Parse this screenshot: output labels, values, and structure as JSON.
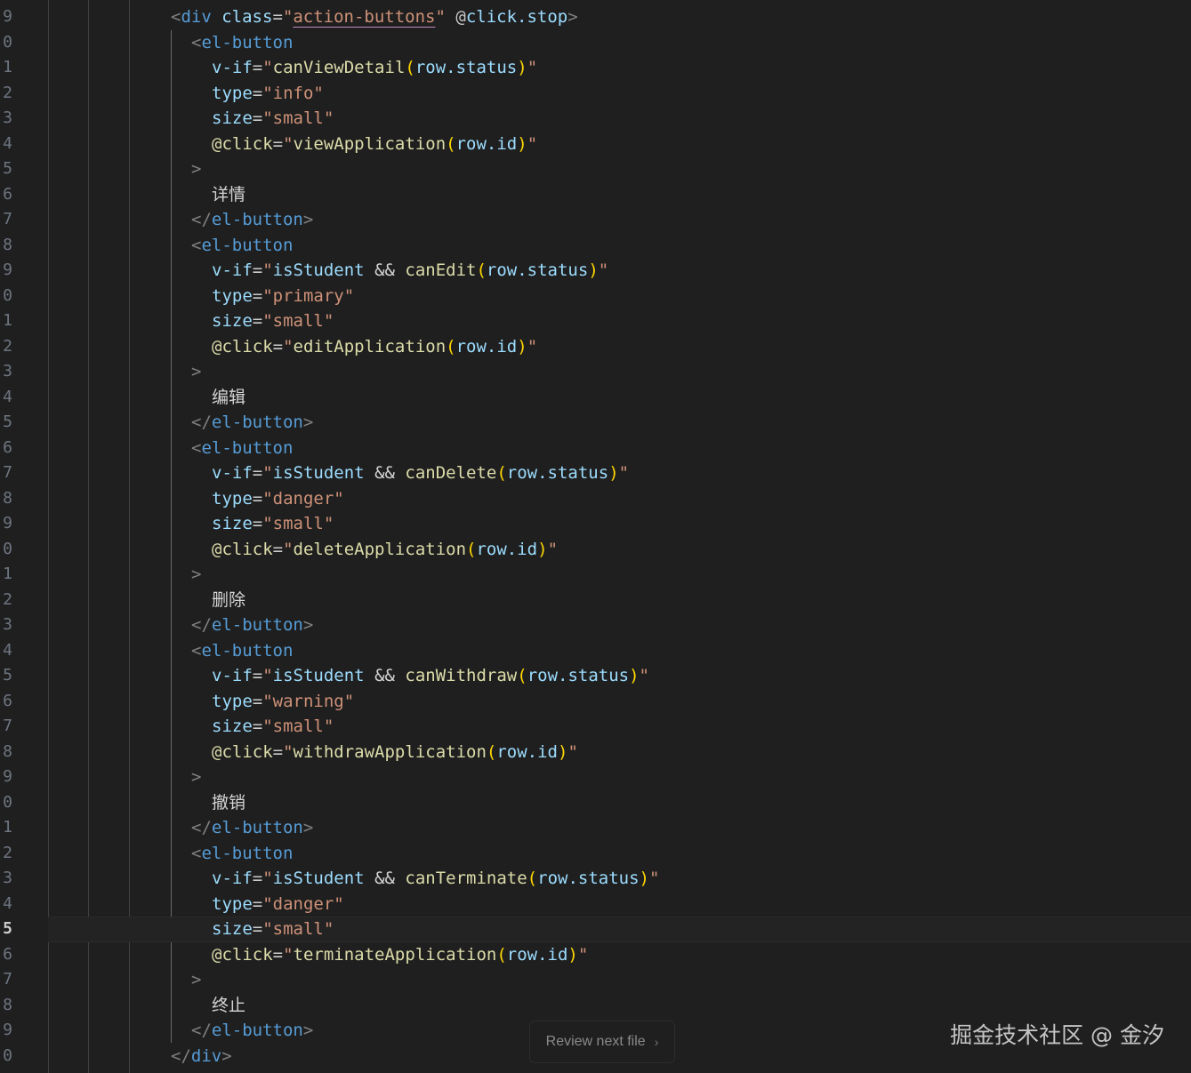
{
  "gutter": {
    "line_numbers": [
      "9",
      "0",
      "1",
      "2",
      "3",
      "4",
      "5",
      "6",
      "7",
      "8",
      "9",
      "0",
      "1",
      "2",
      "3",
      "4",
      "5",
      "6",
      "7",
      "8",
      "9",
      "0",
      "1",
      "2",
      "3",
      "4",
      "5",
      "6",
      "7",
      "8",
      "9",
      "0",
      "1",
      "2",
      "3",
      "4",
      "5",
      "6",
      "7",
      "8",
      "9",
      "0"
    ],
    "active_index": 36
  },
  "code_lines": [
    [
      [
        "t-br",
        "<"
      ],
      [
        "t-tag",
        "div"
      ],
      [
        "t-plain",
        " "
      ],
      [
        "t-attr",
        "class"
      ],
      [
        "t-eq",
        "="
      ],
      [
        "t-str",
        "\""
      ],
      [
        "t-str underlined",
        "action-buttons"
      ],
      [
        "t-str",
        "\""
      ],
      [
        "t-plain",
        " "
      ],
      [
        "t-at",
        "@"
      ],
      [
        "t-attr",
        "click.stop"
      ],
      [
        "t-br",
        ">"
      ]
    ],
    [
      [
        "t-br",
        "<"
      ],
      [
        "t-tag",
        "el-button"
      ]
    ],
    [
      [
        "t-attr",
        "v-if"
      ],
      [
        "t-eq",
        "="
      ],
      [
        "t-str",
        "\""
      ],
      [
        "t-fn",
        "canViewDetail"
      ],
      [
        "t-paren",
        "("
      ],
      [
        "t-var",
        "row.status"
      ],
      [
        "t-paren",
        ")"
      ],
      [
        "t-str",
        "\""
      ]
    ],
    [
      [
        "t-attr",
        "type"
      ],
      [
        "t-eq",
        "="
      ],
      [
        "t-str",
        "\"info\""
      ]
    ],
    [
      [
        "t-attr",
        "size"
      ],
      [
        "t-eq",
        "="
      ],
      [
        "t-str",
        "\"small\""
      ]
    ],
    [
      [
        "t-fn",
        "@click"
      ],
      [
        "t-eq",
        "="
      ],
      [
        "t-str",
        "\""
      ],
      [
        "t-fn",
        "viewApplication"
      ],
      [
        "t-paren",
        "("
      ],
      [
        "t-var",
        "row.id"
      ],
      [
        "t-paren",
        ")"
      ],
      [
        "t-str",
        "\""
      ]
    ],
    [
      [
        "t-br",
        ">"
      ]
    ],
    [
      [
        "t-cjk",
        "详情"
      ]
    ],
    [
      [
        "t-br",
        "</"
      ],
      [
        "t-tag",
        "el-button"
      ],
      [
        "t-br",
        ">"
      ]
    ],
    [
      [
        "t-br",
        "<"
      ],
      [
        "t-tag",
        "el-button"
      ]
    ],
    [
      [
        "t-attr",
        "v-if"
      ],
      [
        "t-eq",
        "="
      ],
      [
        "t-str",
        "\""
      ],
      [
        "t-var",
        "isStudent"
      ],
      [
        "t-plain",
        " && "
      ],
      [
        "t-fn",
        "canEdit"
      ],
      [
        "t-paren",
        "("
      ],
      [
        "t-var",
        "row.status"
      ],
      [
        "t-paren",
        ")"
      ],
      [
        "t-str",
        "\""
      ]
    ],
    [
      [
        "t-attr",
        "type"
      ],
      [
        "t-eq",
        "="
      ],
      [
        "t-str",
        "\"primary\""
      ]
    ],
    [
      [
        "t-attr",
        "size"
      ],
      [
        "t-eq",
        "="
      ],
      [
        "t-str",
        "\"small\""
      ]
    ],
    [
      [
        "t-fn",
        "@click"
      ],
      [
        "t-eq",
        "="
      ],
      [
        "t-str",
        "\""
      ],
      [
        "t-fn",
        "editApplication"
      ],
      [
        "t-paren",
        "("
      ],
      [
        "t-var",
        "row.id"
      ],
      [
        "t-paren",
        ")"
      ],
      [
        "t-str",
        "\""
      ]
    ],
    [
      [
        "t-br",
        ">"
      ]
    ],
    [
      [
        "t-cjk",
        "编辑"
      ]
    ],
    [
      [
        "t-br",
        "</"
      ],
      [
        "t-tag",
        "el-button"
      ],
      [
        "t-br",
        ">"
      ]
    ],
    [
      [
        "t-br",
        "<"
      ],
      [
        "t-tag",
        "el-button"
      ]
    ],
    [
      [
        "t-attr",
        "v-if"
      ],
      [
        "t-eq",
        "="
      ],
      [
        "t-str",
        "\""
      ],
      [
        "t-var",
        "isStudent"
      ],
      [
        "t-plain",
        " && "
      ],
      [
        "t-fn",
        "canDelete"
      ],
      [
        "t-paren",
        "("
      ],
      [
        "t-var",
        "row.status"
      ],
      [
        "t-paren",
        ")"
      ],
      [
        "t-str",
        "\""
      ]
    ],
    [
      [
        "t-attr",
        "type"
      ],
      [
        "t-eq",
        "="
      ],
      [
        "t-str",
        "\"danger\""
      ]
    ],
    [
      [
        "t-attr",
        "size"
      ],
      [
        "t-eq",
        "="
      ],
      [
        "t-str",
        "\"small\""
      ]
    ],
    [
      [
        "t-fn",
        "@click"
      ],
      [
        "t-eq",
        "="
      ],
      [
        "t-str",
        "\""
      ],
      [
        "t-fn",
        "deleteApplication"
      ],
      [
        "t-paren",
        "("
      ],
      [
        "t-var",
        "row.id"
      ],
      [
        "t-paren",
        ")"
      ],
      [
        "t-str",
        "\""
      ]
    ],
    [
      [
        "t-br",
        ">"
      ]
    ],
    [
      [
        "t-cjk",
        "删除"
      ]
    ],
    [
      [
        "t-br",
        "</"
      ],
      [
        "t-tag",
        "el-button"
      ],
      [
        "t-br",
        ">"
      ]
    ],
    [
      [
        "t-br",
        "<"
      ],
      [
        "t-tag",
        "el-button"
      ]
    ],
    [
      [
        "t-attr",
        "v-if"
      ],
      [
        "t-eq",
        "="
      ],
      [
        "t-str",
        "\""
      ],
      [
        "t-var",
        "isStudent"
      ],
      [
        "t-plain",
        " && "
      ],
      [
        "t-fn",
        "canWithdraw"
      ],
      [
        "t-paren",
        "("
      ],
      [
        "t-var",
        "row.status"
      ],
      [
        "t-paren",
        ")"
      ],
      [
        "t-str",
        "\""
      ]
    ],
    [
      [
        "t-attr",
        "type"
      ],
      [
        "t-eq",
        "="
      ],
      [
        "t-str",
        "\"warning\""
      ]
    ],
    [
      [
        "t-attr",
        "size"
      ],
      [
        "t-eq",
        "="
      ],
      [
        "t-str",
        "\"small\""
      ]
    ],
    [
      [
        "t-fn",
        "@click"
      ],
      [
        "t-eq",
        "="
      ],
      [
        "t-str",
        "\""
      ],
      [
        "t-fn",
        "withdrawApplication"
      ],
      [
        "t-paren",
        "("
      ],
      [
        "t-var",
        "row.id"
      ],
      [
        "t-paren",
        ")"
      ],
      [
        "t-str",
        "\""
      ]
    ],
    [
      [
        "t-br",
        ">"
      ]
    ],
    [
      [
        "t-cjk",
        "撤销"
      ]
    ],
    [
      [
        "t-br",
        "</"
      ],
      [
        "t-tag",
        "el-button"
      ],
      [
        "t-br",
        ">"
      ]
    ],
    [
      [
        "t-br",
        "<"
      ],
      [
        "t-tag",
        "el-button"
      ]
    ],
    [
      [
        "t-attr",
        "v-if"
      ],
      [
        "t-eq",
        "="
      ],
      [
        "t-str",
        "\""
      ],
      [
        "t-var",
        "isStudent"
      ],
      [
        "t-plain",
        " && "
      ],
      [
        "t-fn",
        "canTerminate"
      ],
      [
        "t-paren",
        "("
      ],
      [
        "t-var",
        "row.status"
      ],
      [
        "t-paren",
        ")"
      ],
      [
        "t-str",
        "\""
      ]
    ],
    [
      [
        "t-attr",
        "type"
      ],
      [
        "t-eq",
        "="
      ],
      [
        "t-str",
        "\"danger\""
      ]
    ],
    [
      [
        "t-attr",
        "size"
      ],
      [
        "t-eq",
        "="
      ],
      [
        "t-str",
        "\"small\""
      ]
    ],
    [
      [
        "t-fn",
        "@click"
      ],
      [
        "t-eq",
        "="
      ],
      [
        "t-str",
        "\""
      ],
      [
        "t-fn",
        "terminateApplication"
      ],
      [
        "t-paren",
        "("
      ],
      [
        "t-var",
        "row.id"
      ],
      [
        "t-paren",
        ")"
      ],
      [
        "t-str",
        "\""
      ]
    ],
    [
      [
        "t-br",
        ">"
      ]
    ],
    [
      [
        "t-cjk",
        "终止"
      ]
    ],
    [
      [
        "t-br",
        "</"
      ],
      [
        "t-tag",
        "el-button"
      ],
      [
        "t-br",
        ">"
      ]
    ],
    [
      [
        "t-br",
        "</"
      ],
      [
        "t-tag",
        "div"
      ],
      [
        "t-br",
        ">"
      ]
    ]
  ],
  "review_button": {
    "label": "Review next file",
    "icon": "chevron-right-icon"
  },
  "watermark": "掘金技术社区 @ 金汐"
}
